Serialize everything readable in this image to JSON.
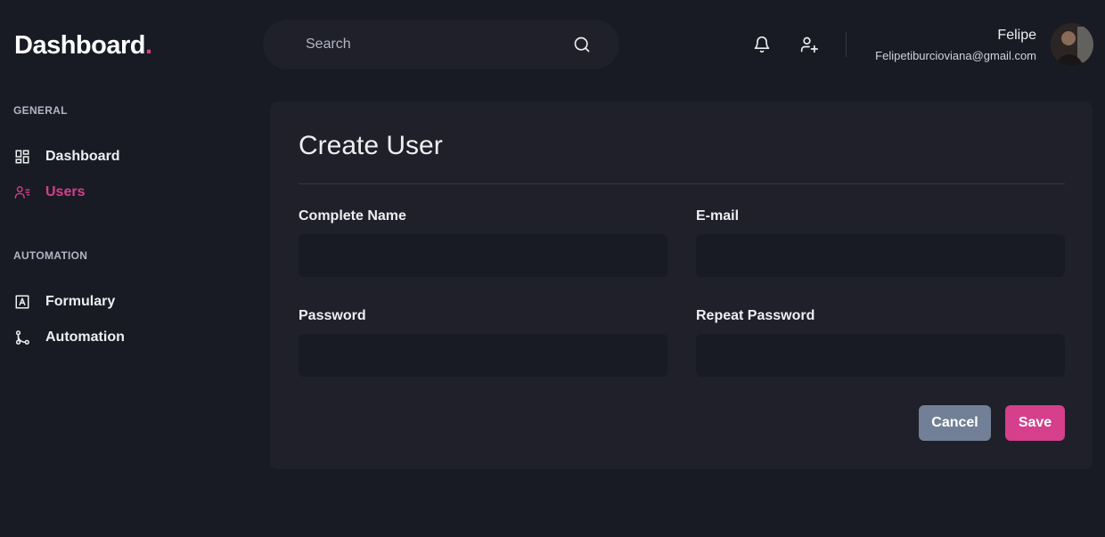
{
  "app": {
    "logo_text": "Dashboard",
    "logo_dot": ".",
    "accent_color": "#d53f8c"
  },
  "header": {
    "search": {
      "placeholder": "Search",
      "value": "",
      "icon": "search-icon"
    },
    "icons": [
      "bell-icon",
      "user-add-icon"
    ],
    "profile": {
      "name": "Felipe",
      "email": "Felipetiburcioviana@gmail.com"
    }
  },
  "sidebar": {
    "sections": [
      {
        "title": "GENERAL",
        "items": [
          {
            "label": "Dashboard",
            "icon": "dashboard-grid-icon",
            "active": false
          },
          {
            "label": "Users",
            "icon": "users-list-icon",
            "active": true
          }
        ]
      },
      {
        "title": "AUTOMATION",
        "items": [
          {
            "label": "Formulary",
            "icon": "form-icon",
            "active": false
          },
          {
            "label": "Automation",
            "icon": "git-merge-icon",
            "active": false
          }
        ]
      }
    ]
  },
  "form": {
    "title": "Create User",
    "fields": [
      {
        "label": "Complete Name",
        "value": ""
      },
      {
        "label": "E-mail",
        "value": ""
      },
      {
        "label": "Password",
        "value": ""
      },
      {
        "label": "Repeat Password",
        "value": ""
      }
    ],
    "cancel_label": "Cancel",
    "save_label": "Save",
    "cancel_color": "#718096",
    "save_color": "#d53f8c"
  }
}
